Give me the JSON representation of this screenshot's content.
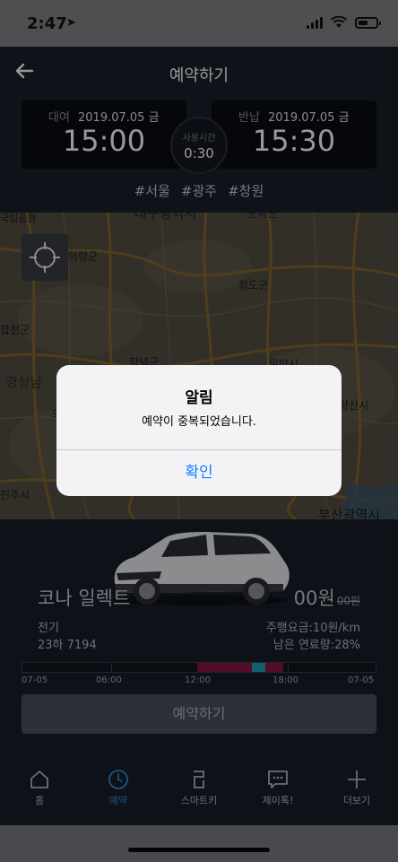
{
  "status_bar": {
    "time": "2:47"
  },
  "header": {
    "title": "예약하기"
  },
  "rental": {
    "label": "대여",
    "date": "2019.07.05 금",
    "time": "15:00"
  },
  "return": {
    "label": "반납",
    "date": "2019.07.05 금",
    "time": "15:30"
  },
  "duration": {
    "label": "사용시간",
    "value": "0:30"
  },
  "tags": [
    "#서울",
    "#광주",
    "#창원"
  ],
  "map": {
    "labels": [
      "국립공원",
      "대구광역시",
      "군위군",
      "의령군",
      "청도군",
      "합천군",
      "창녕군",
      "경상남",
      "밀양시",
      "양산시",
      "부산광역시",
      "진주시",
      "의"
    ]
  },
  "car": {
    "name": "코나 일렉트",
    "price": "00원",
    "original_price": "00원",
    "fuel_type": "전기",
    "plate": "23하 7194",
    "driving_fee": "주행요금:10원/km",
    "remaining_fuel": "남은 연료량:28%"
  },
  "timeline": {
    "labels": [
      "07-05",
      "06:00",
      "12:00",
      "18:00",
      "07-05"
    ],
    "reserved_hours": [
      [
        11.9,
        15.6
      ],
      [
        16.5,
        17.7
      ]
    ],
    "selected_hours": [
      15.6,
      16.5
    ],
    "colors": {
      "reserved": "#8a1346",
      "selected": "#1aa3b4"
    }
  },
  "reserve_button": "예약하기",
  "tabs": [
    {
      "label": "홈",
      "icon": "home-icon"
    },
    {
      "label": "예약",
      "icon": "clock-icon",
      "active": true
    },
    {
      "label": "스마트키",
      "icon": "key-icon"
    },
    {
      "label": "제이톡!",
      "icon": "chat-icon"
    },
    {
      "label": "더보기",
      "icon": "plus-icon"
    }
  ],
  "alert": {
    "title": "알림",
    "message": "예약이 중복되었습니다.",
    "confirm": "확인"
  },
  "accent_color": "#2e8fd8"
}
